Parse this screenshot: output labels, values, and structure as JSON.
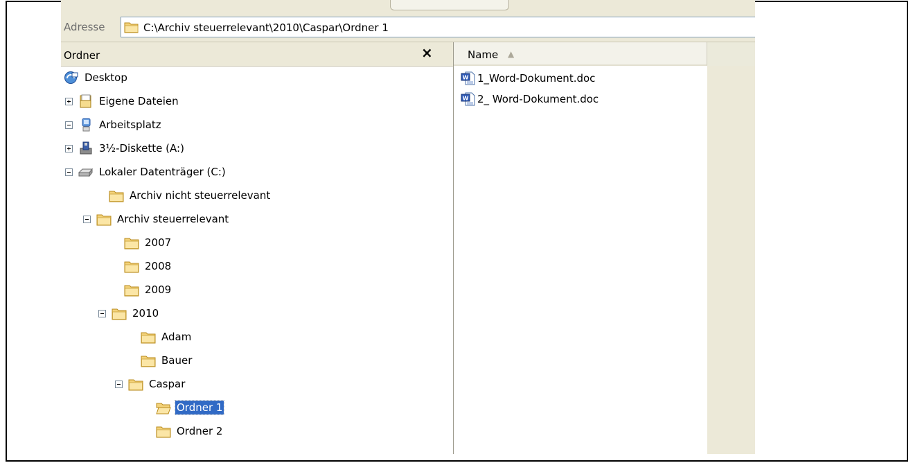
{
  "address": {
    "label": "Adresse",
    "path": "C:\\Archiv steuerrelevant\\2010\\Caspar\\Ordner 1"
  },
  "folder_pane": {
    "title": "Ordner",
    "close_glyph": "×"
  },
  "tree": [
    {
      "label": "Desktop",
      "icon": "desktop-icon",
      "expander": "none",
      "level": 0
    },
    {
      "label": "Eigene Dateien",
      "icon": "my-documents-icon",
      "expander": "plus",
      "level": 1
    },
    {
      "label": "Arbeitsplatz",
      "icon": "my-computer-icon",
      "expander": "minus",
      "level": 1
    },
    {
      "label": "3½-Diskette (A:)",
      "icon": "floppy-drive-icon",
      "expander": "plus",
      "level": 2
    },
    {
      "label": "Lokaler Datenträger (C:)",
      "icon": "hard-drive-icon",
      "expander": "minus",
      "level": 2
    },
    {
      "label": "Archiv nicht steuerrelevant",
      "icon": "folder-icon",
      "expander": "none",
      "level": 3
    },
    {
      "label": "Archiv steuerrelevant",
      "icon": "folder-icon",
      "expander": "minus",
      "level": 3
    },
    {
      "label": "2007",
      "icon": "folder-icon",
      "expander": "none",
      "level": 4
    },
    {
      "label": "2008",
      "icon": "folder-icon",
      "expander": "none",
      "level": 4
    },
    {
      "label": "2009",
      "icon": "folder-icon",
      "expander": "none",
      "level": 4
    },
    {
      "label": "2010",
      "icon": "folder-icon",
      "expander": "minus",
      "level": 4
    },
    {
      "label": "Adam",
      "icon": "folder-icon",
      "expander": "none",
      "level": 5
    },
    {
      "label": "Bauer",
      "icon": "folder-icon",
      "expander": "none",
      "level": 5
    },
    {
      "label": "Caspar",
      "icon": "folder-icon",
      "expander": "minus",
      "level": 5
    },
    {
      "label": "Ordner 1",
      "icon": "open-folder-icon",
      "expander": "none",
      "level": 6,
      "selected": true
    },
    {
      "label": "Ordner 2",
      "icon": "folder-icon",
      "expander": "none",
      "level": 6
    }
  ],
  "files_pane": {
    "column_name": "Name",
    "sort_glyph": "▲",
    "files": [
      {
        "name": "1_Word-Dokument.doc",
        "icon": "word-document-icon"
      },
      {
        "name": "2_ Word-Dokument.doc",
        "icon": "word-document-icon"
      }
    ]
  }
}
